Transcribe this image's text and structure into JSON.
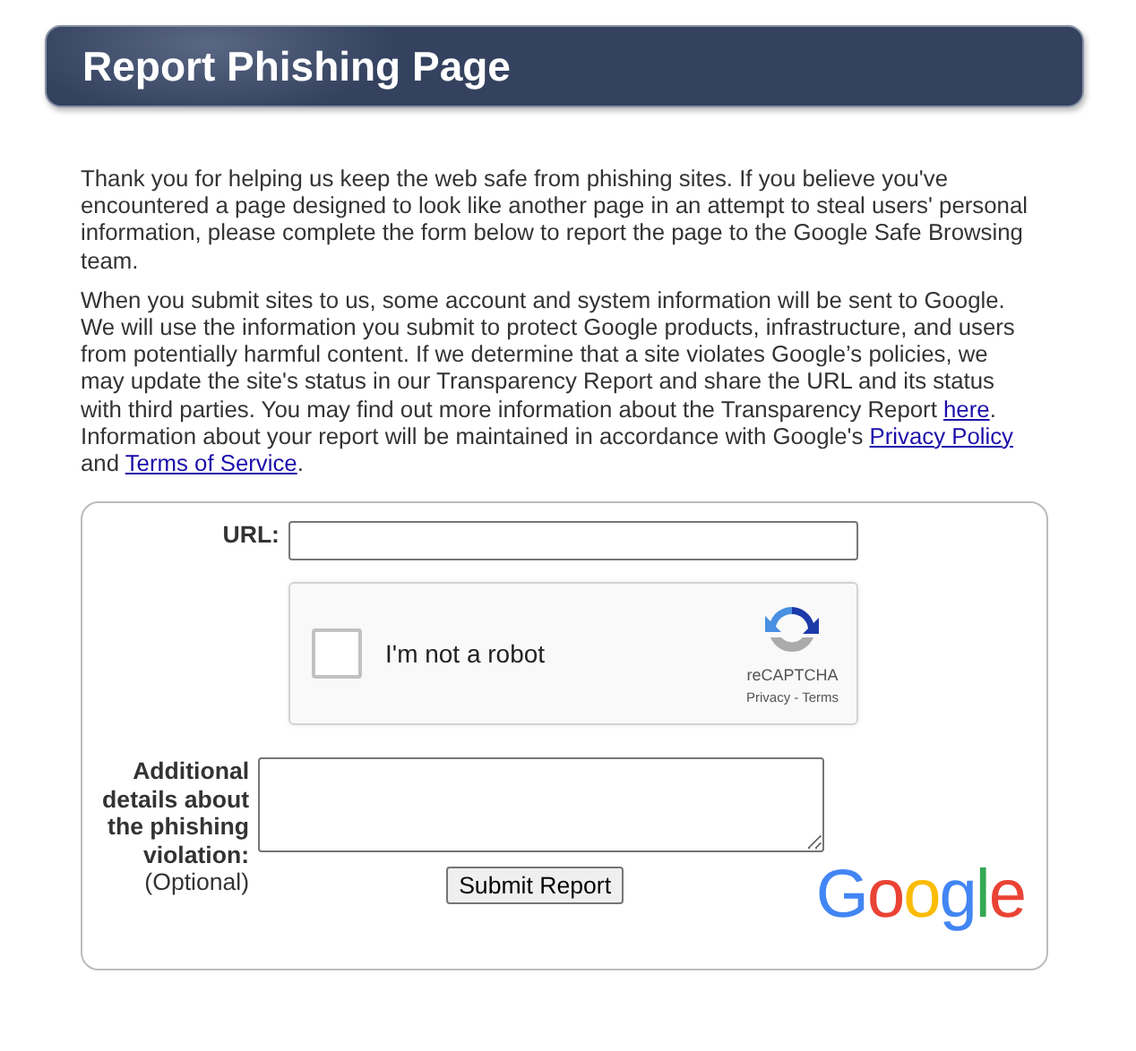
{
  "header": {
    "title": "Report Phishing Page"
  },
  "paragraphs": [
    [
      {
        "kind": "text",
        "text": "Thank you for helping us keep the web safe from phishing sites. If you believe you've encountered a page designed to look like another page in an attempt to steal users' personal information, please complete the form below to report the page to the Google Safe Browsing team."
      }
    ],
    [
      {
        "kind": "text",
        "text": "When you submit sites to us, some account and system information will be sent to Google. We will use the information you submit to protect Google products, infrastructure, and users from potentially harmful content. If we determine that a site violates Google’s policies, we may update the site's status in our Transparency Report and share the URL and its status with third parties. You may find out more information about the Transparency Report "
      },
      {
        "kind": "link",
        "text": "here"
      },
      {
        "kind": "text",
        "text": ". Information about your report will be maintained in accordance with Google's "
      },
      {
        "kind": "link",
        "text": "Privacy Policy"
      },
      {
        "kind": "text",
        "text": " and "
      },
      {
        "kind": "link",
        "text": "Terms of Service"
      },
      {
        "kind": "text",
        "text": "."
      }
    ]
  ],
  "form": {
    "url_label": "URL:",
    "captcha": {
      "label": "I'm not a robot",
      "checked": false,
      "brand": "reCAPTCHA",
      "privacy": "Privacy",
      "separator": "-",
      "terms": "Terms"
    },
    "details_label": "Additional details about the phishing violation:",
    "optional": "(Optional)",
    "submit": "Submit Report",
    "logo": "Google"
  }
}
